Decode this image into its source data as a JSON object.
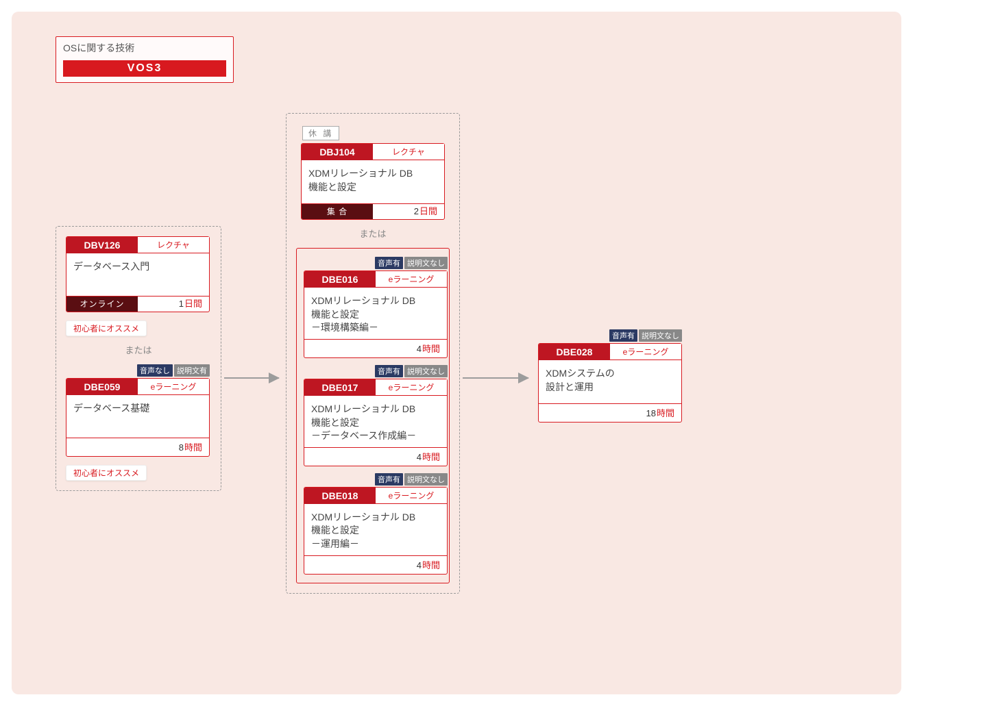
{
  "legend": {
    "category": "OSに関する技術",
    "name": "VOS3"
  },
  "labels": {
    "or": "または",
    "recommend": "初心者にオススメ",
    "suspended": "休 講",
    "tag_audio_yes": "音声有",
    "tag_audio_no": "音声なし",
    "tag_desc_yes": "説明文有",
    "tag_desc_no": "説明文なし",
    "type_lecture": "レクチャ",
    "type_elearn": "eラーニング",
    "fmt_online": "オンライン",
    "fmt_group": "集 合",
    "unit_days": "日間",
    "unit_hours": "時間"
  },
  "col1": {
    "cardA": {
      "code": "DBV126",
      "title": "データベース入門",
      "dur_num": "1"
    },
    "cardB": {
      "code": "DBE059",
      "title": "データベース基礎",
      "dur_num": "8"
    }
  },
  "col2": {
    "cardTop": {
      "code": "DBJ104",
      "title": "XDMリレーショナル DB\n機能と設定",
      "dur_num": "2"
    },
    "cardE1": {
      "code": "DBE016",
      "title": "XDMリレーショナル DB\n機能と設定\n－環境構築編－",
      "dur_num": "4"
    },
    "cardE2": {
      "code": "DBE017",
      "title": "XDMリレーショナル DB\n機能と設定\n－データベース作成編－",
      "dur_num": "4"
    },
    "cardE3": {
      "code": "DBE018",
      "title": "XDMリレーショナル DB\n機能と設定\n－運用編－",
      "dur_num": "4"
    }
  },
  "col3": {
    "card": {
      "code": "DBE028",
      "title": "XDMシステムの\n設計と運用",
      "dur_num": "18"
    }
  }
}
